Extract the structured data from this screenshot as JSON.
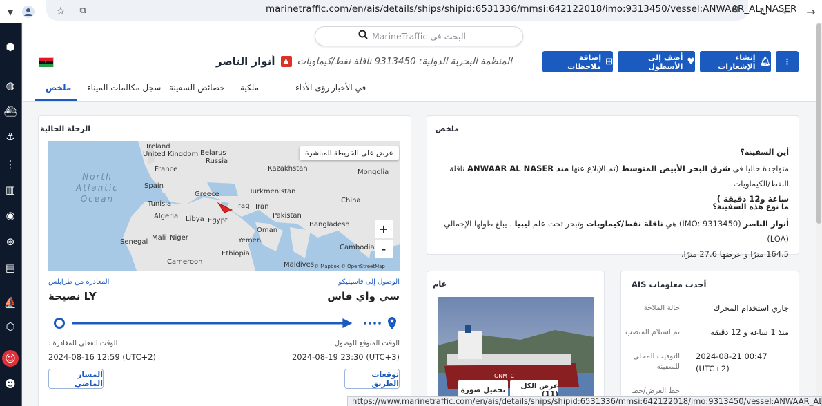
{
  "browser": {
    "url_host": "marinetraffic.com",
    "url_path": "/en/ais/details/ships/shipid:6531336/mmsi:642122018/imo:9313450/vessel:ANWAAR_AL_NASER",
    "status_url": "https://www.marinetraffic.com/en/ais/details/ships/shipid:6531336/mmsi:642122018/imo:9313450/vessel:ANWAAR_AL_NASER#overview"
  },
  "search": {
    "placeholder": "البحث في MarineTraffic"
  },
  "actions": {
    "more": "⋮",
    "alerts": "إنشاء الإشعارات",
    "fleet": "أضف إلى الأسطول",
    "notes": "إضافة ملاحظات"
  },
  "vessel": {
    "name": "أنوار الناصر",
    "meta": "المنظمة البحرية الدولية: 9313450  ناقلة نفط/كيماويات",
    "flag": "Libya"
  },
  "tabs": [
    "ملخص",
    "سجل مكالمات الميناء",
    "خصائص السفينة",
    "ملكية",
    "رؤى الأداء",
    "في الأخبار"
  ],
  "voyage": {
    "title": "الرحلة الحالية",
    "live_map": "عرض على الخريطة المباشرة",
    "map_labels": {
      "ocean": "North Atlantic Ocean",
      "iceland": "",
      "uk": "United Kingdom",
      "belarus": "Belarus",
      "russia": "Russia",
      "france": "France",
      "kazakhstan": "Kazakhstan",
      "mongolia": "Mongolia",
      "spain": "Spain",
      "turkmenistan": "Turkmenistan",
      "greece": "Greece",
      "tunisia": "Tunisia",
      "iraq": "Iraq",
      "iran": "Iran",
      "china": "China",
      "algeria": "Algeria",
      "libya": "Libya",
      "egypt": "Egypt",
      "pakistan": "Pakistan",
      "bangladesh": "Bangladesh",
      "oman": "Oman",
      "senegal": "Senegal",
      "mali": "Mali",
      "niger": "Niger",
      "yemen": "Yemen",
      "cambodia": "Cambodia",
      "ethiopia": "Ethiopia",
      "cameroon": "Cameroon",
      "maldives": "Maldives",
      "attribution": "© Mapbox © OpenStreetMap"
    },
    "zoom_in": "+",
    "zoom_out": "-",
    "departure_label": "المغادرة من طرابلس",
    "departure_port": "LY نصيحة",
    "arrival_label": "الوصول إلى فاسيليكو",
    "arrival_port": "سي واي فاس",
    "atd_label": "الوقت الفعلي للمغادرة :",
    "atd": "2024-08-16 12:59 (UTC+2)",
    "eta_label": "الوقت المتوقع للوصول :",
    "eta": "2024-08-19 23:30 (UTC+3)",
    "past_track": "المسار الماضي",
    "route_forecast": "توقعات الطريق",
    "progress": 0.9
  },
  "summary": {
    "title": "ملخص",
    "q1": "أين السفينة؟",
    "a1_pre": "متواجدة حاليا في",
    "a1_loc": "شرق البحر الأبيض المتوسط",
    "a1_mid": "(تم الإبلاغ عنها",
    "a1_since": "منذ",
    "a1_vessel": "ANWAAR AL NASER",
    "a1_type": "ناقلة النفط/الكيماويات",
    "a1_time": "ساعة و12 دقيقة )",
    "q2": "ما نوع هذه السفينة؟",
    "a2_name": "أنوار الناصر",
    "a2_imo": "(IMO: 9313450)",
    "a2_is": "هي",
    "a2_type": "ناقلة نفط/كيماويات",
    "a2_flag_pre": "وتبحر تحت علم",
    "a2_flag": "ليبيا",
    "a2_loa": ". يبلغ طولها الإجمالي (LOA)",
    "a2_dims": "164.5 مترًا و عرضها 27.6 مترًا."
  },
  "general": {
    "title": "عام",
    "upload": "تحميل صورة",
    "view_all": "عرض الكل (11)"
  },
  "ais": {
    "title": "أحدث معلومات AIS",
    "rows": [
      {
        "label": "حالة الملاحة",
        "value": "جاري استخدام المحرك"
      },
      {
        "label": "تم استلام المنصب",
        "value": "منذ 1 ساعة و 12 دقيقة"
      },
      {
        "label": "التوقيت المحلي للسفينة",
        "value": "2024-08-21 00:47 (UTC+2)"
      },
      {
        "label": "خط العرض/خط",
        "value": ""
      }
    ]
  },
  "colors": {
    "primary": "#1b5bbf",
    "rail": "#0e1a2b",
    "alert_red": "#e0313a"
  }
}
